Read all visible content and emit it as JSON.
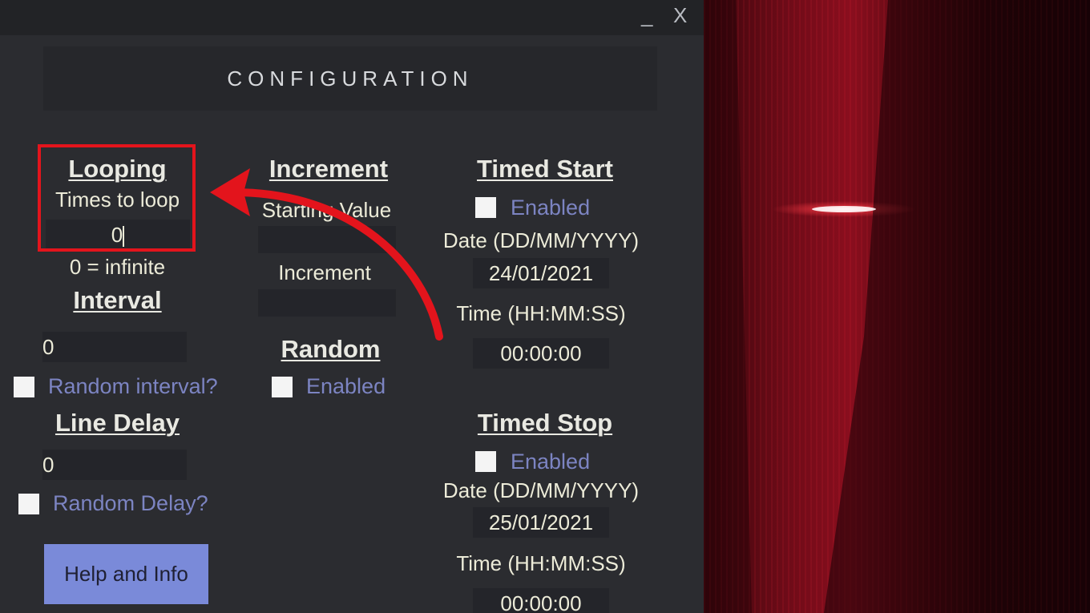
{
  "window": {
    "minimize_label": "_",
    "close_label": "X",
    "header_title": "CONFIGURATION"
  },
  "looping": {
    "heading": "Looping",
    "times_label": "Times to loop",
    "times_value": "0",
    "infinite_note": "0 = infinite"
  },
  "interval": {
    "heading": "Interval",
    "value": "0",
    "random_label": "Random interval?"
  },
  "line_delay": {
    "heading": "Line Delay",
    "value": "0",
    "random_label": "Random Delay?"
  },
  "increment": {
    "heading": "Increment",
    "starting_label": "Starting Value",
    "starting_value": "",
    "increment_label": "Increment",
    "increment_value": ""
  },
  "random": {
    "heading": "Random",
    "enabled_label": "Enabled"
  },
  "timed_start": {
    "heading": "Timed Start",
    "enabled_label": "Enabled",
    "date_label": "Date (DD/MM/YYYY)",
    "date_value": "24/01/2021",
    "time_label": "Time (HH:MM:SS)",
    "time_value": "00:00:00"
  },
  "timed_stop": {
    "heading": "Timed Stop",
    "enabled_label": "Enabled",
    "date_label": "Date (DD/MM/YYYY)",
    "date_value": "25/01/2021",
    "time_label": "Time (HH:MM:SS)",
    "time_value": "00:00:00"
  },
  "help_button_label": "Help and Info",
  "colors": {
    "panel_bg": "#2b2c30",
    "field_bg": "#24252a",
    "checkbox_label": "#7c84c2",
    "help_button": "#7a8ad9",
    "annotation_red": "#e3141c"
  }
}
